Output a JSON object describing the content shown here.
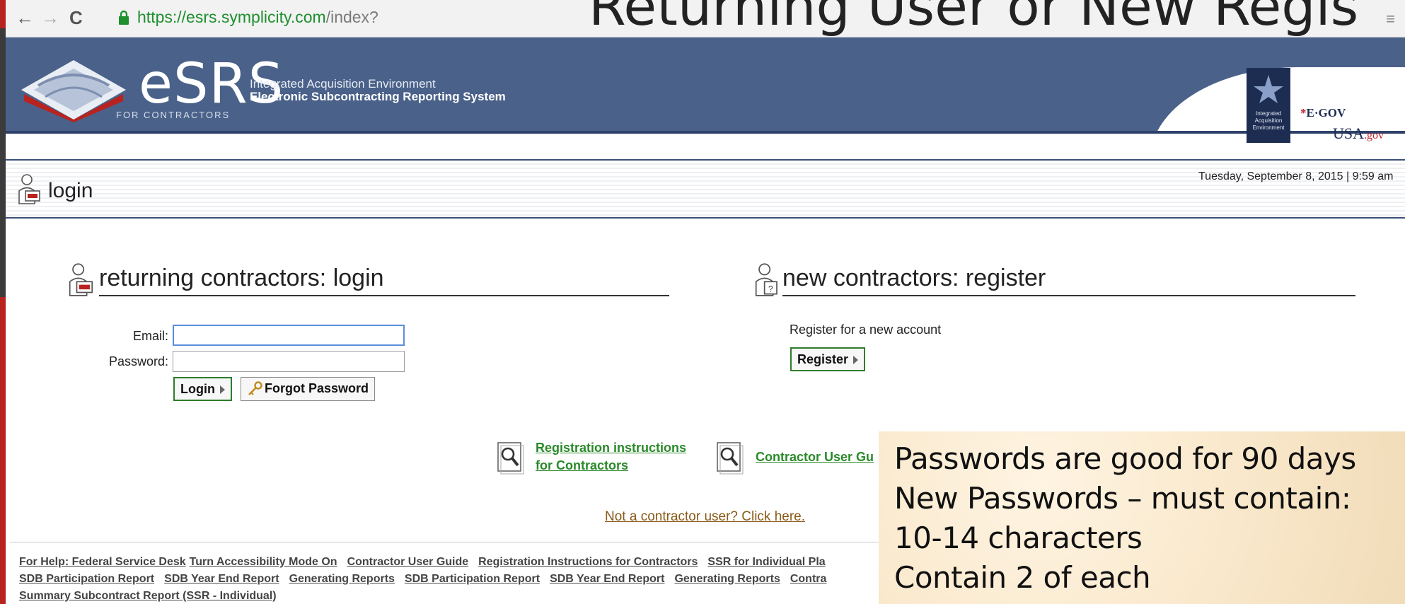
{
  "browser": {
    "url_domain": "https://esrs.symplicity.com",
    "url_path": "/index?",
    "nav_back": "←",
    "nav_forward": "→",
    "nav_reload": "C",
    "menu_icon": "≡"
  },
  "slide": {
    "title": "Returning User or New Regis"
  },
  "header": {
    "logo_text": "eSRS",
    "logo_subtitle": "FOR CONTRACTORS",
    "program_line": "Integrated Acquisition Environment",
    "system_name": "Electronic Subcontracting Reporting System",
    "iae_badge": "Integrated Acquisition Environment",
    "egov": "E·GOV",
    "usagov_usa": "USA",
    "usagov_gov": ".gov"
  },
  "page": {
    "title": "login",
    "datetime": "Tuesday, September 8, 2015 | 9:59 am"
  },
  "login_section": {
    "heading": "returning contractors: login",
    "email_label": "Email:",
    "email_value": "",
    "password_label": "Password:",
    "password_value": "",
    "login_button": "Login",
    "forgot_button": "Forgot Password"
  },
  "register_section": {
    "heading": "new contractors: register",
    "text": "Register for a new account",
    "register_button": "Register"
  },
  "docs": {
    "registration_line1": "Registration instructions",
    "registration_line2": "for Contractors",
    "user_guide": "Contractor User Gu"
  },
  "not_contractor": "Not a contractor user? Click here.",
  "footer": {
    "row1": [
      "For Help: Federal Service Desk",
      "Turn Accessibility Mode On",
      "Contractor User Guide",
      "Registration Instructions for Contractors",
      "SSR for Individual Pla"
    ],
    "row2": [
      "SDB Participation Report",
      "SDB Year End Report",
      "Generating Reports",
      "SDB Participation Report",
      "SDB Year End Report",
      "Generating Reports",
      "Contra"
    ],
    "row3": [
      "Summary Subcontract Report (SSR - Individual)"
    ]
  },
  "note": {
    "line1": "Passwords are good for 90 days",
    "line2": "New Passwords – must contain:",
    "line3": "10-14 characters",
    "line4": "Contain 2 of each"
  }
}
